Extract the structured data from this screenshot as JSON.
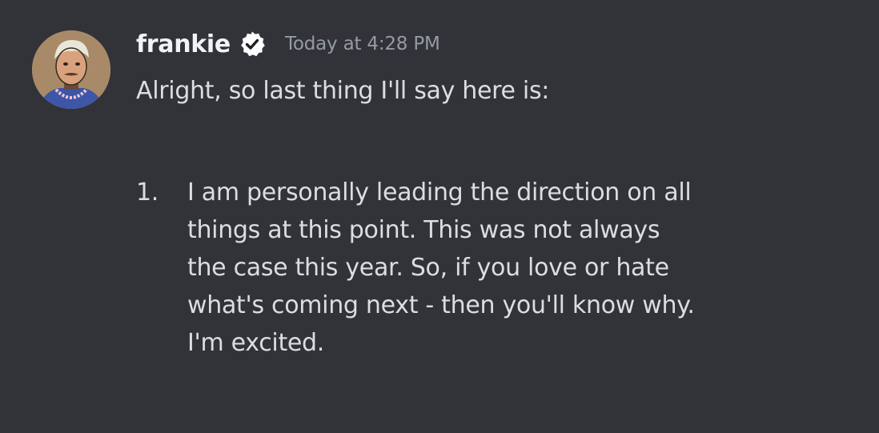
{
  "message": {
    "author": {
      "name": "frankie",
      "verified": true,
      "avatar_icon": "cartoon-portrait-avatar",
      "badge_icon": "verified-check-badge-icon"
    },
    "timestamp": "Today at 4:28 PM",
    "intro": "Alright, so last thing I'll say here is:",
    "list": [
      {
        "number": "1.",
        "lines": [
          "I am personally leading the direction on all",
          "things at this point. This was not always",
          "the case this year. So, if you love or hate",
          "what's coming next - then you'll know why.",
          "I'm excited."
        ]
      }
    ]
  },
  "colors": {
    "background": "#313338",
    "username": "#f2f3f5",
    "timestamp": "#949ba4",
    "text": "#dbdee1",
    "badge": "#ffffff"
  }
}
